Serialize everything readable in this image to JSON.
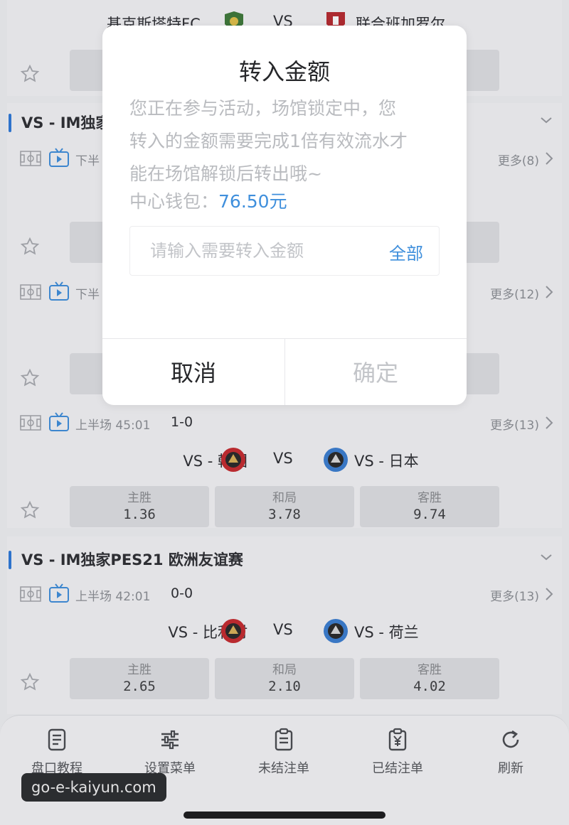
{
  "top_match": {
    "home": "基克斯塔特FC",
    "vs": "VS",
    "away": "联合班加罗尔"
  },
  "league_1": {
    "name": "VS - IM独家"
  },
  "match_b": {
    "period": "下半",
    "more": "更多(8)"
  },
  "match_c": {
    "period": "下半",
    "more": "更多(12)"
  },
  "match_d": {
    "period": "上半场 45:01",
    "score": "1-0",
    "more": "更多(13)",
    "home": "VS - 韩国",
    "vs": "VS",
    "away": "VS - 日本",
    "odds": [
      {
        "label": "主胜",
        "value": "1.36"
      },
      {
        "label": "和局",
        "value": "3.78"
      },
      {
        "label": "客胜",
        "value": "9.74"
      }
    ]
  },
  "league_2": {
    "name": "VS - IM独家PES21 欧洲友谊赛"
  },
  "match_e": {
    "period": "上半场 42:01",
    "score": "0-0",
    "more": "更多(13)",
    "home": "VS - 比利时",
    "vs": "VS",
    "away": "VS - 荷兰",
    "odds": [
      {
        "label": "主胜",
        "value": "2.65"
      },
      {
        "label": "和局",
        "value": "2.10"
      },
      {
        "label": "客胜",
        "value": "4.02"
      }
    ]
  },
  "nav": [
    {
      "label": "盘口教程",
      "icon": "document-icon"
    },
    {
      "label": "设置菜单",
      "icon": "sliders-icon"
    },
    {
      "label": "未结注单",
      "icon": "clipboard-icon"
    },
    {
      "label": "已结注单",
      "icon": "yen-clipboard-icon"
    },
    {
      "label": "刷新",
      "icon": "refresh-icon"
    }
  ],
  "watermark": "go-e-kaiyun.com",
  "dialog": {
    "title": "转入金额",
    "message_lines": [
      "您正在参与活动，场馆锁定中，您",
      "转入的金额需要完成1倍有效流水才",
      "能在场馆解锁后转出哦~"
    ],
    "wallet_label": "中心钱包：",
    "wallet_amount": "76.50元",
    "input_placeholder": "请输入需要转入金额",
    "all_label": "全部",
    "cancel_label": "取消",
    "confirm_label": "确定"
  },
  "colors": {
    "accent": "#3f8fdc",
    "league_bar": "#2f7ad8"
  }
}
